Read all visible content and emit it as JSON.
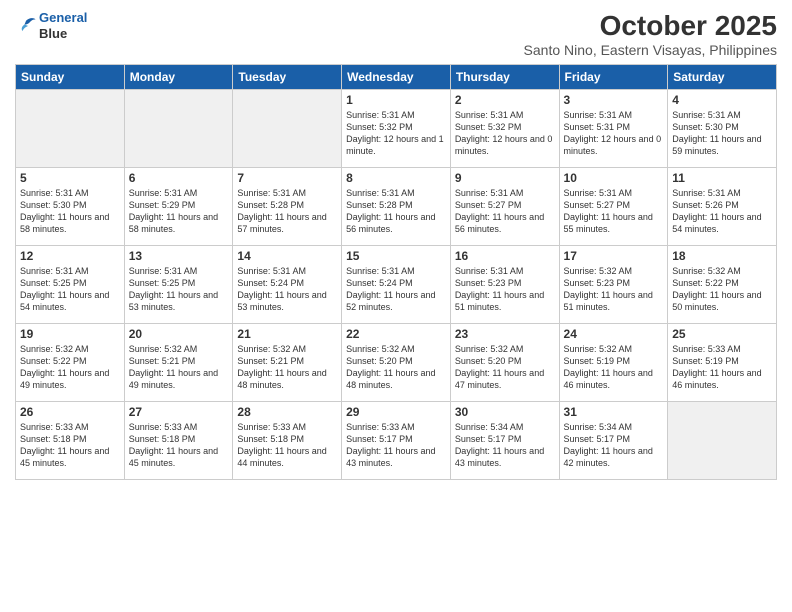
{
  "header": {
    "logo_line1": "General",
    "logo_line2": "Blue",
    "month": "October 2025",
    "location": "Santo Nino, Eastern Visayas, Philippines"
  },
  "days_of_week": [
    "Sunday",
    "Monday",
    "Tuesday",
    "Wednesday",
    "Thursday",
    "Friday",
    "Saturday"
  ],
  "weeks": [
    [
      {
        "day": "",
        "empty": true
      },
      {
        "day": "",
        "empty": true
      },
      {
        "day": "",
        "empty": true
      },
      {
        "day": "1",
        "sunrise": "5:31 AM",
        "sunset": "5:32 PM",
        "daylight": "12 hours and 1 minute."
      },
      {
        "day": "2",
        "sunrise": "5:31 AM",
        "sunset": "5:32 PM",
        "daylight": "12 hours and 0 minutes."
      },
      {
        "day": "3",
        "sunrise": "5:31 AM",
        "sunset": "5:31 PM",
        "daylight": "12 hours and 0 minutes."
      },
      {
        "day": "4",
        "sunrise": "5:31 AM",
        "sunset": "5:30 PM",
        "daylight": "11 hours and 59 minutes."
      }
    ],
    [
      {
        "day": "5",
        "sunrise": "5:31 AM",
        "sunset": "5:30 PM",
        "daylight": "11 hours and 58 minutes."
      },
      {
        "day": "6",
        "sunrise": "5:31 AM",
        "sunset": "5:29 PM",
        "daylight": "11 hours and 58 minutes."
      },
      {
        "day": "7",
        "sunrise": "5:31 AM",
        "sunset": "5:28 PM",
        "daylight": "11 hours and 57 minutes."
      },
      {
        "day": "8",
        "sunrise": "5:31 AM",
        "sunset": "5:28 PM",
        "daylight": "11 hours and 56 minutes."
      },
      {
        "day": "9",
        "sunrise": "5:31 AM",
        "sunset": "5:27 PM",
        "daylight": "11 hours and 56 minutes."
      },
      {
        "day": "10",
        "sunrise": "5:31 AM",
        "sunset": "5:27 PM",
        "daylight": "11 hours and 55 minutes."
      },
      {
        "day": "11",
        "sunrise": "5:31 AM",
        "sunset": "5:26 PM",
        "daylight": "11 hours and 54 minutes."
      }
    ],
    [
      {
        "day": "12",
        "sunrise": "5:31 AM",
        "sunset": "5:25 PM",
        "daylight": "11 hours and 54 minutes."
      },
      {
        "day": "13",
        "sunrise": "5:31 AM",
        "sunset": "5:25 PM",
        "daylight": "11 hours and 53 minutes."
      },
      {
        "day": "14",
        "sunrise": "5:31 AM",
        "sunset": "5:24 PM",
        "daylight": "11 hours and 53 minutes."
      },
      {
        "day": "15",
        "sunrise": "5:31 AM",
        "sunset": "5:24 PM",
        "daylight": "11 hours and 52 minutes."
      },
      {
        "day": "16",
        "sunrise": "5:31 AM",
        "sunset": "5:23 PM",
        "daylight": "11 hours and 51 minutes."
      },
      {
        "day": "17",
        "sunrise": "5:32 AM",
        "sunset": "5:23 PM",
        "daylight": "11 hours and 51 minutes."
      },
      {
        "day": "18",
        "sunrise": "5:32 AM",
        "sunset": "5:22 PM",
        "daylight": "11 hours and 50 minutes."
      }
    ],
    [
      {
        "day": "19",
        "sunrise": "5:32 AM",
        "sunset": "5:22 PM",
        "daylight": "11 hours and 49 minutes."
      },
      {
        "day": "20",
        "sunrise": "5:32 AM",
        "sunset": "5:21 PM",
        "daylight": "11 hours and 49 minutes."
      },
      {
        "day": "21",
        "sunrise": "5:32 AM",
        "sunset": "5:21 PM",
        "daylight": "11 hours and 48 minutes."
      },
      {
        "day": "22",
        "sunrise": "5:32 AM",
        "sunset": "5:20 PM",
        "daylight": "11 hours and 48 minutes."
      },
      {
        "day": "23",
        "sunrise": "5:32 AM",
        "sunset": "5:20 PM",
        "daylight": "11 hours and 47 minutes."
      },
      {
        "day": "24",
        "sunrise": "5:32 AM",
        "sunset": "5:19 PM",
        "daylight": "11 hours and 46 minutes."
      },
      {
        "day": "25",
        "sunrise": "5:33 AM",
        "sunset": "5:19 PM",
        "daylight": "11 hours and 46 minutes."
      }
    ],
    [
      {
        "day": "26",
        "sunrise": "5:33 AM",
        "sunset": "5:18 PM",
        "daylight": "11 hours and 45 minutes."
      },
      {
        "day": "27",
        "sunrise": "5:33 AM",
        "sunset": "5:18 PM",
        "daylight": "11 hours and 45 minutes."
      },
      {
        "day": "28",
        "sunrise": "5:33 AM",
        "sunset": "5:18 PM",
        "daylight": "11 hours and 44 minutes."
      },
      {
        "day": "29",
        "sunrise": "5:33 AM",
        "sunset": "5:17 PM",
        "daylight": "11 hours and 43 minutes."
      },
      {
        "day": "30",
        "sunrise": "5:34 AM",
        "sunset": "5:17 PM",
        "daylight": "11 hours and 43 minutes."
      },
      {
        "day": "31",
        "sunrise": "5:34 AM",
        "sunset": "5:17 PM",
        "daylight": "11 hours and 42 minutes."
      },
      {
        "day": "",
        "empty": true
      }
    ]
  ]
}
